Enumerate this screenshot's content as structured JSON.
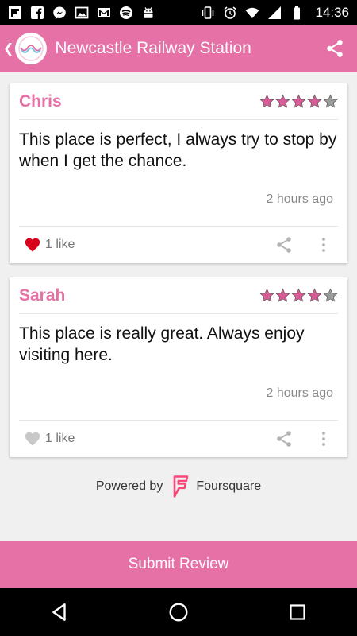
{
  "status_bar": {
    "time": "14:36",
    "left_icons": [
      "flipboard-icon",
      "facebook-icon",
      "messenger-icon",
      "image-icon",
      "gmail-icon",
      "spotify-icon",
      "android-icon"
    ],
    "right_icons": [
      "vibrate-icon",
      "alarm-icon",
      "wifi-icon",
      "signal-icon",
      "battery-icon"
    ]
  },
  "app_bar": {
    "title": "Newcastle Railway Station",
    "color": "#e671a6"
  },
  "reviews": [
    {
      "name": "Chris",
      "rating": 4,
      "max_rating": 5,
      "text": "This place is perfect, I always try to stop by when I get the chance.",
      "time": "2 hours ago",
      "likes": "1 like",
      "liked": true
    },
    {
      "name": "Sarah",
      "rating": 4,
      "max_rating": 5,
      "text": "This place is really great. Always enjoy visiting here.",
      "time": "2 hours ago",
      "likes": "1 like",
      "liked": false
    }
  ],
  "powered_by": {
    "prefix": "Powered by",
    "brand": "Foursquare",
    "brand_color": "#f94877"
  },
  "submit": {
    "label": "Submit Review"
  },
  "colors": {
    "accent": "#e671a6",
    "star_filled": "#d85a96",
    "star_empty": "#9a9a9a",
    "heart_liked": "#d9001b",
    "heart_unliked": "#c8c8c8"
  }
}
